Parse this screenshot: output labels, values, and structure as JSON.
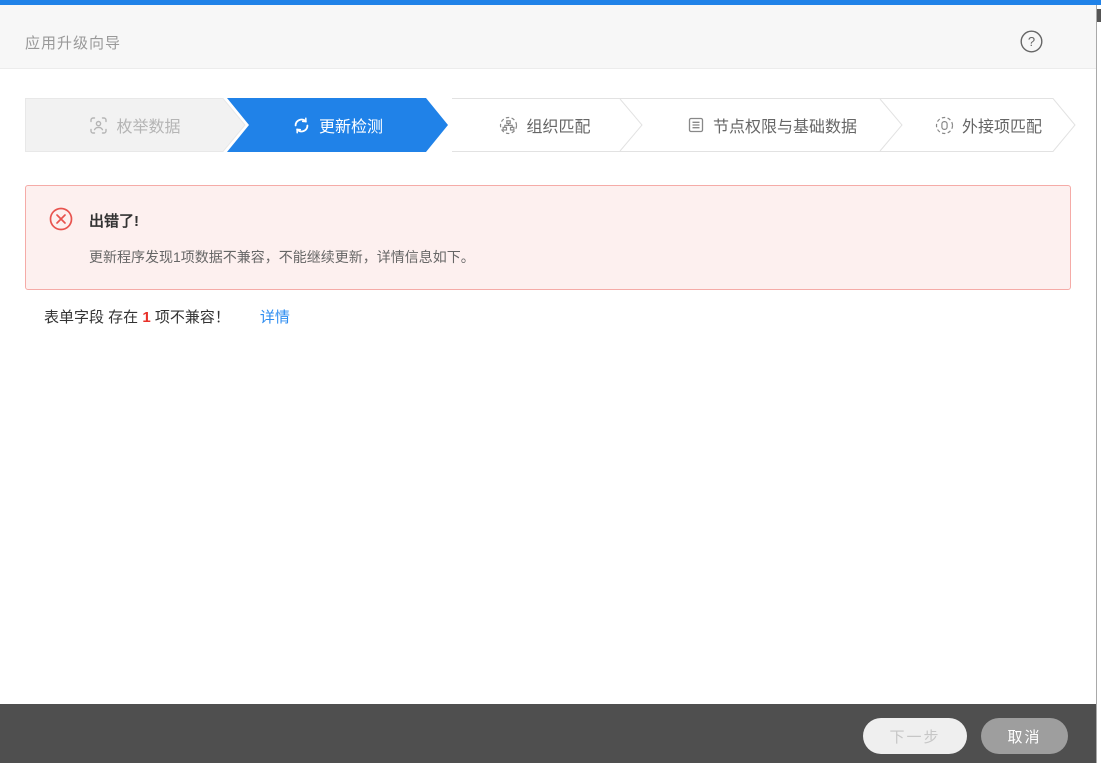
{
  "window": {
    "title": "应用升级向导"
  },
  "header": {
    "help_glyph": "?"
  },
  "steps": {
    "items": [
      {
        "label": "枚举数据",
        "icon": "enum-data-icon",
        "state": "done"
      },
      {
        "label": "更新检测",
        "icon": "refresh-icon",
        "state": "active"
      },
      {
        "label": "组织匹配",
        "icon": "org-match-icon",
        "state": "pending"
      },
      {
        "label": "节点权限与基础数据",
        "icon": "node-permission-icon",
        "state": "pending"
      },
      {
        "label": "外接项匹配",
        "icon": "external-item-icon",
        "state": "pending"
      }
    ]
  },
  "error_banner": {
    "title": "出错了!",
    "message": "更新程序发现1项数据不兼容，不能继续更新，详情信息如下。"
  },
  "incompatibility_row": {
    "prefix": "表单字段 存在 ",
    "count": "1",
    "suffix": " 项不兼容！",
    "detail_link": "详情"
  },
  "footer": {
    "next_label": "下一步",
    "cancel_label": "取消"
  },
  "colors": {
    "accent_blue": "#2082e8",
    "header_bg": "#f7f7f7",
    "inactive_step_bg": "#f2f2f2",
    "error_bg": "#fdf0ef",
    "error_border": "#f5aba7",
    "error_red": "#e8534e",
    "count_red": "#e8312a",
    "link_blue": "#2d8cf0",
    "footer_bg": "#4f4f4f",
    "cancel_btn_bg": "#9e9e9e"
  }
}
